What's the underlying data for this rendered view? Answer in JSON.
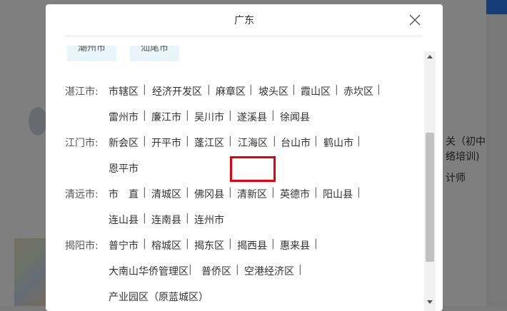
{
  "modal": {
    "title": "广东"
  },
  "chips": [
    "潮州市",
    "汕尾市"
  ],
  "rows": [
    {
      "label": "湛江市:",
      "districts": [
        "市辖区",
        "经济开发区",
        "麻章区",
        "坡头区",
        "霞山区",
        "赤坎区"
      ]
    },
    {
      "label": "",
      "districts": [
        "雷州市",
        "廉江市",
        "吴川市",
        "遂溪县",
        "徐闻县"
      ]
    },
    {
      "label": "江门市:",
      "districts": [
        "新会区",
        "开平市",
        "蓬江区",
        "江海区",
        "台山市",
        "鹤山市"
      ]
    },
    {
      "label": "",
      "districts": [
        "恩平市"
      ]
    },
    {
      "label": "清远市:",
      "districts": [
        "市　直",
        "清城区",
        "佛冈县",
        "清新区",
        "英德市",
        "阳山县"
      ]
    },
    {
      "label": "",
      "districts": [
        "连山县",
        "连南县",
        "连州市"
      ]
    },
    {
      "label": "揭阳市:",
      "districts": [
        "普宁市",
        "榕城区",
        "揭东区",
        "揭西县",
        "惠来县"
      ]
    },
    {
      "label": "",
      "districts": [
        "大南山华侨管理区",
        "普侨区",
        "空港经济区"
      ]
    },
    {
      "label": "",
      "districts": [
        "产业园区（原蓝城区）"
      ]
    }
  ],
  "separator": "|",
  "background": {
    "text1": "关（初中",
    "text2": "络培训)",
    "text3": "计师"
  },
  "colors": {
    "highlight": "#e3000b",
    "chip_bg": "#eaf5fb"
  }
}
